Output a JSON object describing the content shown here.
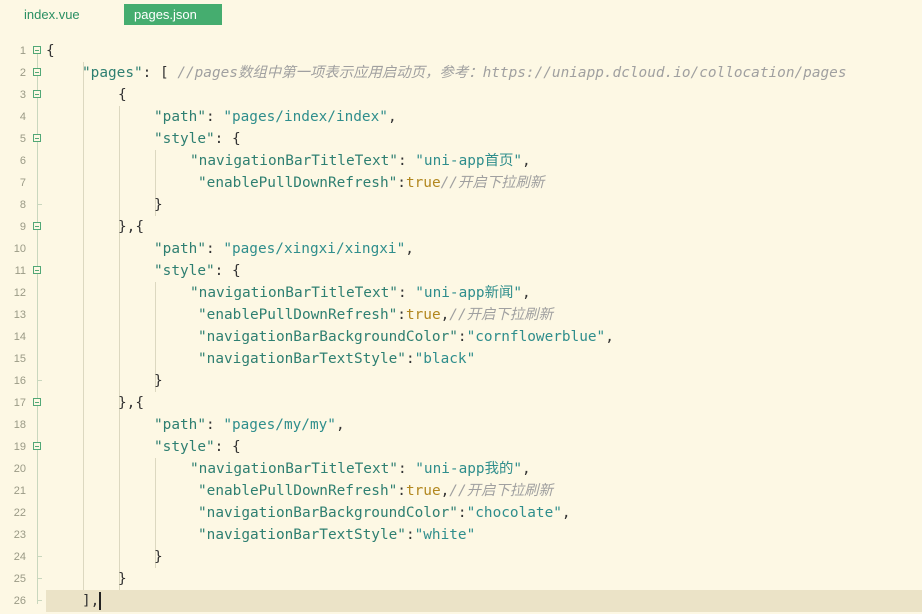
{
  "tabs": [
    {
      "label": "index.vue",
      "active": false
    },
    {
      "label": "pages.json",
      "active": true
    }
  ],
  "lines": [
    {
      "n": "1",
      "fold": true,
      "indent": 0,
      "tokens": [
        {
          "t": "{",
          "c": "punc"
        }
      ]
    },
    {
      "n": "2",
      "fold": true,
      "indent": 1,
      "tokens": [
        {
          "t": "\"pages\"",
          "c": "key"
        },
        {
          "t": ": [ ",
          "c": "punc"
        },
        {
          "t": "//pages数组中第一项表示应用启动页，参考：https://uniapp.dcloud.io/collocation/pages",
          "c": "cmt"
        }
      ]
    },
    {
      "n": "3",
      "fold": true,
      "indent": 2,
      "tokens": [
        {
          "t": "{",
          "c": "punc"
        }
      ]
    },
    {
      "n": "4",
      "fold": false,
      "indent": 3,
      "tokens": [
        {
          "t": "\"path\"",
          "c": "key"
        },
        {
          "t": ": ",
          "c": "punc"
        },
        {
          "t": "\"pages/index/index\"",
          "c": "str"
        },
        {
          "t": ",",
          "c": "punc"
        }
      ]
    },
    {
      "n": "5",
      "fold": true,
      "indent": 3,
      "tokens": [
        {
          "t": "\"style\"",
          "c": "key"
        },
        {
          "t": ": {",
          "c": "punc"
        }
      ]
    },
    {
      "n": "6",
      "fold": false,
      "indent": 4,
      "tokens": [
        {
          "t": "\"navigationBarTitleText\"",
          "c": "key"
        },
        {
          "t": ": ",
          "c": "punc"
        },
        {
          "t": "\"uni-app首页\"",
          "c": "str"
        },
        {
          "t": ",",
          "c": "punc"
        }
      ]
    },
    {
      "n": "7",
      "fold": false,
      "indent": 4,
      "offset": true,
      "tokens": [
        {
          "t": "\"enablePullDownRefresh\"",
          "c": "key"
        },
        {
          "t": ":",
          "c": "punc"
        },
        {
          "t": "true",
          "c": "kw"
        },
        {
          "t": "//开启下拉刷新",
          "c": "cmt"
        }
      ]
    },
    {
      "n": "8",
      "fold": false,
      "end": true,
      "indent": 3,
      "tokens": [
        {
          "t": "}",
          "c": "punc"
        }
      ]
    },
    {
      "n": "9",
      "fold": true,
      "indent": 2,
      "tokens": [
        {
          "t": "},{",
          "c": "punc"
        }
      ]
    },
    {
      "n": "10",
      "fold": false,
      "indent": 3,
      "tokens": [
        {
          "t": "\"path\"",
          "c": "key"
        },
        {
          "t": ": ",
          "c": "punc"
        },
        {
          "t": "\"pages/xingxi/xingxi\"",
          "c": "str"
        },
        {
          "t": ",",
          "c": "punc"
        }
      ]
    },
    {
      "n": "11",
      "fold": true,
      "indent": 3,
      "tokens": [
        {
          "t": "\"style\"",
          "c": "key"
        },
        {
          "t": ": {",
          "c": "punc"
        }
      ]
    },
    {
      "n": "12",
      "fold": false,
      "indent": 4,
      "tokens": [
        {
          "t": "\"navigationBarTitleText\"",
          "c": "key"
        },
        {
          "t": ": ",
          "c": "punc"
        },
        {
          "t": "\"uni-app新闻\"",
          "c": "str"
        },
        {
          "t": ",",
          "c": "punc"
        }
      ]
    },
    {
      "n": "13",
      "fold": false,
      "indent": 4,
      "offset": true,
      "tokens": [
        {
          "t": "\"enablePullDownRefresh\"",
          "c": "key"
        },
        {
          "t": ":",
          "c": "punc"
        },
        {
          "t": "true",
          "c": "kw"
        },
        {
          "t": ",",
          "c": "punc"
        },
        {
          "t": "//开启下拉刷新",
          "c": "cmt"
        }
      ]
    },
    {
      "n": "14",
      "fold": false,
      "indent": 4,
      "offset": true,
      "tokens": [
        {
          "t": "\"navigationBarBackgroundColor\"",
          "c": "key"
        },
        {
          "t": ":",
          "c": "punc"
        },
        {
          "t": "\"cornflowerblue\"",
          "c": "str"
        },
        {
          "t": ",",
          "c": "punc"
        }
      ]
    },
    {
      "n": "15",
      "fold": false,
      "indent": 4,
      "offset": true,
      "tokens": [
        {
          "t": "\"navigationBarTextStyle\"",
          "c": "key"
        },
        {
          "t": ":",
          "c": "punc"
        },
        {
          "t": "\"black\"",
          "c": "str"
        }
      ]
    },
    {
      "n": "16",
      "fold": false,
      "end": true,
      "indent": 3,
      "tokens": [
        {
          "t": "}",
          "c": "punc"
        }
      ]
    },
    {
      "n": "17",
      "fold": true,
      "indent": 2,
      "tokens": [
        {
          "t": "},{",
          "c": "punc"
        }
      ]
    },
    {
      "n": "18",
      "fold": false,
      "indent": 3,
      "tokens": [
        {
          "t": "\"path\"",
          "c": "key"
        },
        {
          "t": ": ",
          "c": "punc"
        },
        {
          "t": "\"pages/my/my\"",
          "c": "str"
        },
        {
          "t": ",",
          "c": "punc"
        }
      ]
    },
    {
      "n": "19",
      "fold": true,
      "indent": 3,
      "tokens": [
        {
          "t": "\"style\"",
          "c": "key"
        },
        {
          "t": ": {",
          "c": "punc"
        }
      ]
    },
    {
      "n": "20",
      "fold": false,
      "indent": 4,
      "tokens": [
        {
          "t": "\"navigationBarTitleText\"",
          "c": "key"
        },
        {
          "t": ": ",
          "c": "punc"
        },
        {
          "t": "\"uni-app我的\"",
          "c": "str"
        },
        {
          "t": ",",
          "c": "punc"
        }
      ]
    },
    {
      "n": "21",
      "fold": false,
      "indent": 4,
      "offset": true,
      "tokens": [
        {
          "t": "\"enablePullDownRefresh\"",
          "c": "key"
        },
        {
          "t": ":",
          "c": "punc"
        },
        {
          "t": "true",
          "c": "kw"
        },
        {
          "t": ",",
          "c": "punc"
        },
        {
          "t": "//开启下拉刷新",
          "c": "cmt"
        }
      ]
    },
    {
      "n": "22",
      "fold": false,
      "indent": 4,
      "offset": true,
      "tokens": [
        {
          "t": "\"navigationBarBackgroundColor\"",
          "c": "key"
        },
        {
          "t": ":",
          "c": "punc"
        },
        {
          "t": "\"chocolate\"",
          "c": "str"
        },
        {
          "t": ",",
          "c": "punc"
        }
      ]
    },
    {
      "n": "23",
      "fold": false,
      "indent": 4,
      "offset": true,
      "tokens": [
        {
          "t": "\"navigationBarTextStyle\"",
          "c": "key"
        },
        {
          "t": ":",
          "c": "punc"
        },
        {
          "t": "\"white\"",
          "c": "str"
        }
      ]
    },
    {
      "n": "24",
      "fold": false,
      "end": true,
      "indent": 3,
      "tokens": [
        {
          "t": "}",
          "c": "punc"
        }
      ]
    },
    {
      "n": "25",
      "fold": false,
      "end": true,
      "indent": 2,
      "tokens": [
        {
          "t": "}",
          "c": "punc"
        }
      ]
    },
    {
      "n": "26",
      "fold": false,
      "end": true,
      "indent": 1,
      "current": true,
      "tokens": [
        {
          "t": "],",
          "c": "punc"
        }
      ]
    }
  ]
}
